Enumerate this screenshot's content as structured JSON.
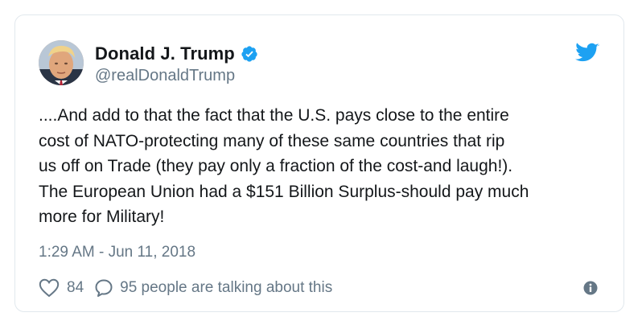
{
  "author": {
    "display_name": "Donald J. Trump",
    "handle": "@realDonaldTrump",
    "verified": true,
    "avatar_icon": "profile-photo"
  },
  "tweet": {
    "text": "....And add to that the fact that the U.S. pays close to the entire\ncost of NATO-protecting many of these same countries that rip\nus off on Trade (they pay only a fraction of the cost-and laugh!).\nThe European Union had a $151 Billion Surplus-should pay much\nmore for Military!",
    "timestamp": "1:29 AM - Jun 11, 2018"
  },
  "engagement": {
    "likes": "84",
    "talking": "95 people are talking about this"
  },
  "icons": {
    "brand": "twitter-bird-icon",
    "verified": "verified-badge-icon",
    "like": "heart-icon",
    "reply": "reply-bubble-icon",
    "info": "info-icon"
  },
  "colors": {
    "brand_blue": "#1da1f2",
    "text_primary": "#14171a",
    "text_secondary": "#657786",
    "border": "#e1e8ed"
  }
}
